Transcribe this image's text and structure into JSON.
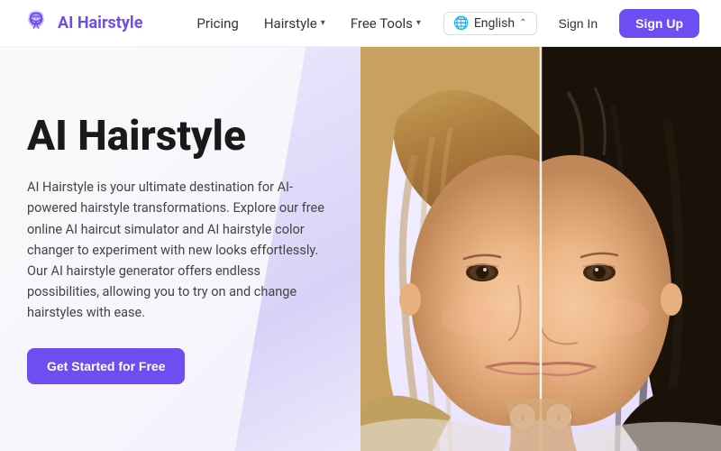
{
  "nav": {
    "logo_text": "AI Hairstyle",
    "logo_icon_alt": "ai-hairstyle-logo",
    "links": [
      {
        "label": "Pricing",
        "has_dropdown": false
      },
      {
        "label": "Hairstyle",
        "has_dropdown": true
      },
      {
        "label": "Free Tools",
        "has_dropdown": true
      }
    ],
    "lang_selector": {
      "icon": "🌐",
      "label": "English"
    },
    "sign_in_label": "Sign In",
    "sign_up_label": "Sign Up"
  },
  "hero": {
    "title": "AI Hairstyle",
    "description": "AI Hairstyle is your ultimate destination for AI-powered hairstyle transformations. Explore our free online AI haircut simulator and AI hairstyle color changer to experiment with new looks effortlessly. Our AI hairstyle generator offers endless possibilities, allowing you to try on and change hairstyles with ease.",
    "cta_label": "Get Started for Free"
  },
  "image_slider": {
    "left_arrow": "‹",
    "right_arrow": "›"
  },
  "colors": {
    "brand_purple": "#6c4ef2",
    "text_dark": "#1a1a1a",
    "text_muted": "#444"
  }
}
